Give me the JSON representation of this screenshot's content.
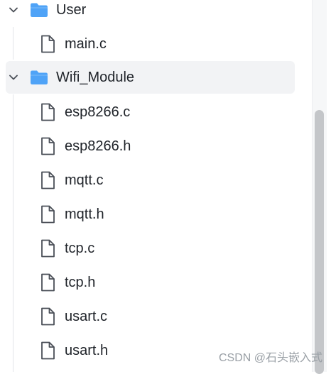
{
  "tree": {
    "folders": [
      {
        "label": "User",
        "expanded": true,
        "icon": "folder-icon"
      },
      {
        "label": "Wifi_Module",
        "expanded": true,
        "icon": "folder-icon",
        "selected": true
      }
    ],
    "user_files": [
      "main.c"
    ],
    "wifi_files": [
      "esp8266.c",
      "esp8266.h",
      "mqtt.c",
      "mqtt.h",
      "tcp.c",
      "tcp.h",
      "usart.c",
      "usart.h"
    ]
  },
  "colors": {
    "folder_blue": "#4fa3f7",
    "selected_bg": "#f2f3f5",
    "icon_gray": "#4a4f57",
    "scrollbar_thumb": "#c4c6c9"
  },
  "watermark": "CSDN @石头嵌入式"
}
